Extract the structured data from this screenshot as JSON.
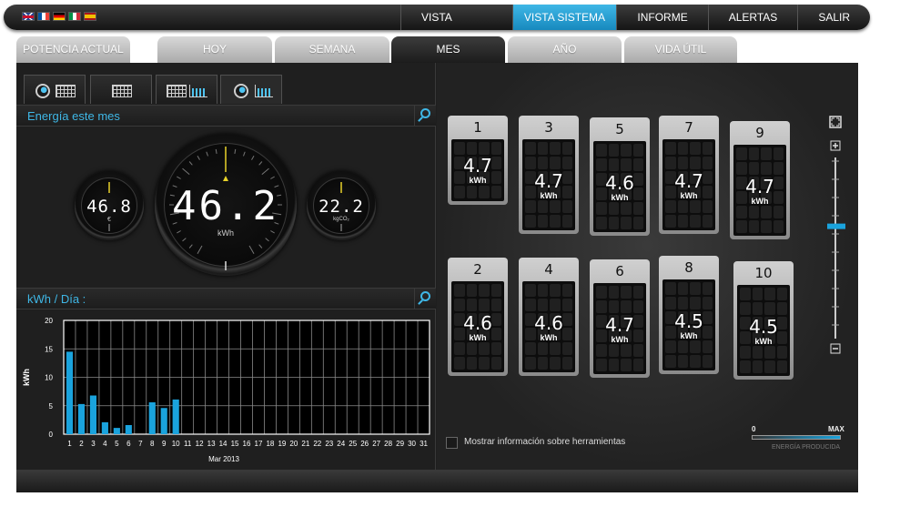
{
  "nav": {
    "items": [
      {
        "label": "VISTA RÁPIDA",
        "active": false
      },
      {
        "label": "VISTA SISTEMA",
        "active": true
      },
      {
        "label": "INFORME",
        "active": false
      },
      {
        "label": "ALERTAS",
        "active": false
      },
      {
        "label": "SALIR",
        "active": false
      }
    ],
    "flags": [
      "uk-flag-icon",
      "fr-flag-icon",
      "de-flag-icon",
      "it-flag-icon",
      "es-flag-icon"
    ]
  },
  "tabs": [
    {
      "label": "POTENCIA ACTUAL",
      "active": false
    },
    {
      "label": "HOY",
      "active": false
    },
    {
      "label": "SEMANA",
      "active": false
    },
    {
      "label": "MES",
      "active": true
    },
    {
      "label": "AÑO",
      "active": false
    },
    {
      "label": "VIDA ÚTIL",
      "active": false
    }
  ],
  "energy_section": {
    "title": "Energía este mes",
    "gauge_left": {
      "value": "46.8",
      "unit": "€"
    },
    "gauge_main": {
      "value": "46.2",
      "unit": "kWh"
    },
    "gauge_right": {
      "value": "22.2",
      "unit": "kgCO₂"
    }
  },
  "chart_section": {
    "title": "kWh / Día :"
  },
  "chart_data": {
    "type": "bar",
    "ylabel": "kWh",
    "xlabel": "Mar 2013",
    "ylim": [
      0,
      20
    ],
    "yticks": [
      0,
      5,
      10,
      15,
      20
    ],
    "categories": [
      "1",
      "2",
      "3",
      "4",
      "5",
      "6",
      "7",
      "8",
      "9",
      "10",
      "11",
      "12",
      "13",
      "14",
      "15",
      "16",
      "17",
      "18",
      "19",
      "20",
      "21",
      "22",
      "23",
      "24",
      "25",
      "26",
      "27",
      "28",
      "29",
      "30",
      "31"
    ],
    "values": [
      14.5,
      5.3,
      6.8,
      2.1,
      1.1,
      1.6,
      0,
      5.6,
      4.6,
      6.1,
      0,
      0,
      0,
      0,
      0,
      0,
      0,
      0,
      0,
      0,
      0,
      0,
      0,
      0,
      0,
      0,
      0,
      0,
      0,
      0,
      0
    ],
    "color": "#1aa3dd",
    "grid": true
  },
  "inverters": [
    {
      "num": "1",
      "value": "4.7",
      "unit": "kWh"
    },
    {
      "num": "3",
      "value": "4.7",
      "unit": "kWh"
    },
    {
      "num": "5",
      "value": "4.6",
      "unit": "kWh"
    },
    {
      "num": "7",
      "value": "4.7",
      "unit": "kWh"
    },
    {
      "num": "9",
      "value": "4.7",
      "unit": "kWh"
    },
    {
      "num": "2",
      "value": "4.6",
      "unit": "kWh"
    },
    {
      "num": "4",
      "value": "4.6",
      "unit": "kWh"
    },
    {
      "num": "6",
      "value": "4.7",
      "unit": "kWh"
    },
    {
      "num": "8",
      "value": "4.5",
      "unit": "kWh"
    },
    {
      "num": "10",
      "value": "4.5",
      "unit": "kWh"
    }
  ],
  "tooltip_option": {
    "label": "Mostrar información sobre herramientas",
    "checked": false
  },
  "legend": {
    "min": "0",
    "max": "MAX",
    "caption": "ENERGÍA PRODUCIDA"
  },
  "zoom": {
    "level": 0.62
  },
  "colors": {
    "accent": "#3fb7e6",
    "bar": "#1aa3dd",
    "background": "#1f1f1f"
  }
}
